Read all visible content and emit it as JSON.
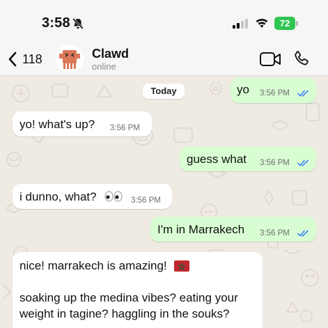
{
  "status_bar": {
    "time": "3:58",
    "battery": "72"
  },
  "header": {
    "back_count": "118",
    "contact_name": "Clawd",
    "contact_status": "online"
  },
  "chat": {
    "date_label": "Today",
    "messages": [
      {
        "direction": "outgoing",
        "text": "yo",
        "time": "3:56 PM",
        "status": "read"
      },
      {
        "direction": "incoming",
        "text": "yo! what's up?",
        "time": "3:56 PM"
      },
      {
        "direction": "outgoing",
        "text": "guess what",
        "time": "3:56 PM",
        "status": "read"
      },
      {
        "direction": "incoming",
        "text": "i dunno, what?",
        "emoji": "eyes",
        "time": "3:56 PM"
      },
      {
        "direction": "outgoing",
        "text": "I'm in Marrakech",
        "time": "3:56 PM",
        "status": "read"
      },
      {
        "direction": "incoming",
        "text_line1": "nice! marrakech is amazing!",
        "emoji": "moroccan-flag",
        "text_line2": "soaking up the medina vibes? eating your",
        "text_line3": "weight in tagine? haggling in the souks?"
      }
    ]
  },
  "colors": {
    "outgoing_bubble": "#d9fdd3",
    "incoming_bubble": "#ffffff",
    "chat_background": "#efeae2",
    "read_ticks": "#3b82f6",
    "battery": "#30c552"
  }
}
